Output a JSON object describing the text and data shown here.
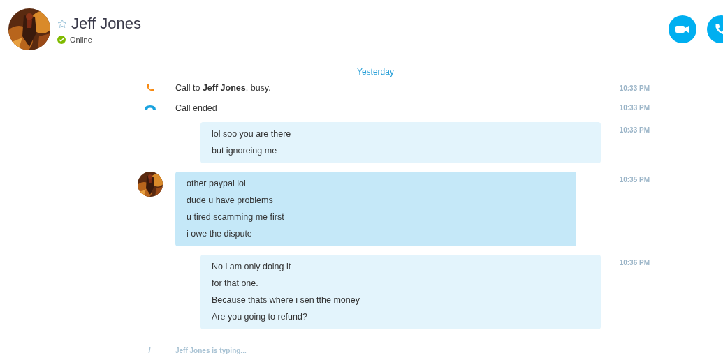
{
  "contact": {
    "name": "Jeff Jones",
    "status": "Online",
    "favorite": false
  },
  "day_label": "Yesterday",
  "messages": [
    {
      "kind": "call_attempt",
      "text": "Call to **Jeff Jones**, busy.",
      "time": "10:33 PM"
    },
    {
      "kind": "call_end",
      "text": "Call ended",
      "time": "10:33 PM"
    },
    {
      "kind": "outgoing",
      "lines": [
        "lol soo you are there",
        "but ignoreing me"
      ],
      "time": "10:33 PM"
    },
    {
      "kind": "incoming",
      "lines": [
        "other paypal lol",
        "dude u have problems",
        "u tired scamming me first",
        "i owe the dispute"
      ],
      "time": "10:35 PM"
    },
    {
      "kind": "outgoing",
      "lines": [
        "No i am only doing it",
        "for that one.",
        "Because thats where i sen tthe money",
        "Are you going to refund?"
      ],
      "time": "10:36 PM"
    }
  ],
  "typing": "Jeff Jones is typing..."
}
